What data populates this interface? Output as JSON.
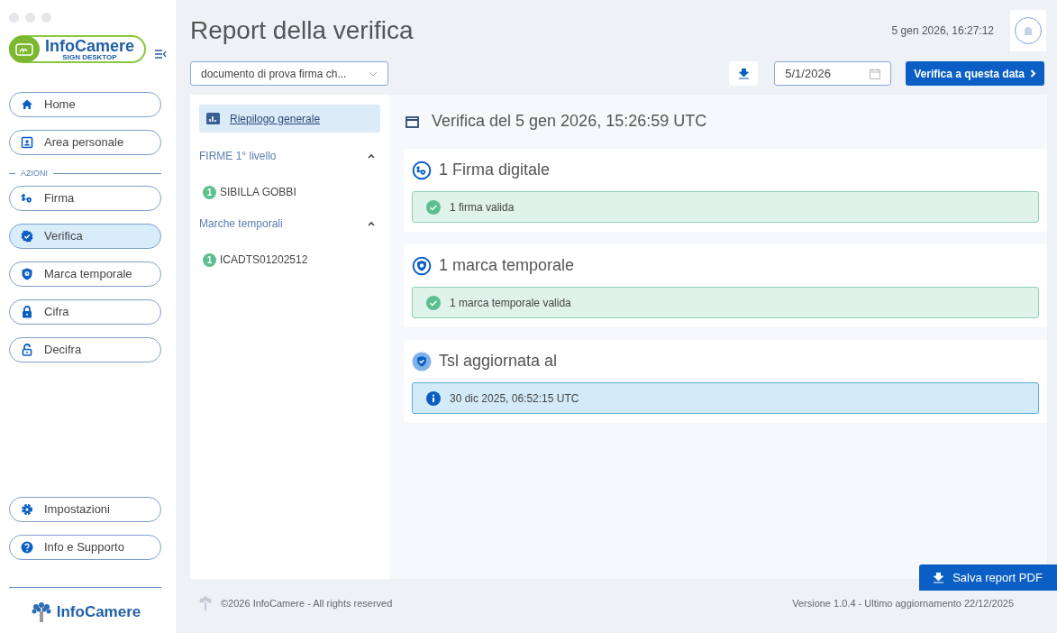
{
  "logo": {
    "title": "InfoCamere",
    "subtitle": "SIGN DESKTOP"
  },
  "nav_top": [
    {
      "label": "Home",
      "selected": false
    },
    {
      "label": "Area personale",
      "selected": false
    }
  ],
  "section_label": "AZIONI",
  "nav_actions": [
    {
      "label": "Firma",
      "selected": false
    },
    {
      "label": "Verifica",
      "selected": true
    },
    {
      "label": "Marca temporale",
      "selected": false
    },
    {
      "label": "Cifra",
      "selected": false
    },
    {
      "label": "Decifra",
      "selected": false
    }
  ],
  "nav_bottom": [
    {
      "label": "Impostazioni",
      "selected": false
    },
    {
      "label": "Info e Supporto",
      "selected": false
    }
  ],
  "brand_footer": "InfoCamere",
  "page_title": "Report della verifica",
  "datetime": "5 gen 2026, 16:27:12",
  "document_select": {
    "value": "documento di prova firma ch..."
  },
  "date_field": {
    "value": "5/1/2026"
  },
  "verify_button": "Verifica a questa data",
  "tree": {
    "summary": {
      "label": "Riepilogo generale",
      "selected": true
    },
    "groups": [
      {
        "label": "FIRME 1° livello",
        "expanded": true,
        "children": [
          {
            "count": "1",
            "label": "SIBILLA GOBBI"
          }
        ]
      },
      {
        "label": "Marche temporali",
        "expanded": true,
        "children": [
          {
            "count": "1",
            "label": "ICADTS01202512"
          }
        ]
      }
    ]
  },
  "verification_heading": "Verifica del 5 gen 2026, 15:26:59 UTC",
  "cards": [
    {
      "title": "1 Firma digitale",
      "status": {
        "kind": "success",
        "text": "1 firma valida"
      }
    },
    {
      "title": "1 marca temporale",
      "status": {
        "kind": "success",
        "text": "1 marca temporale valida"
      }
    },
    {
      "title": "Tsl aggiornata al",
      "status": {
        "kind": "info",
        "text": "30 dic 2025, 06:52:15 UTC"
      }
    }
  ],
  "save_button": "Salva report PDF",
  "footer": {
    "copyright": "©2026 InfoCamere - All rights reserved",
    "version": "Versione 1.0.4 - Ultimo aggiornamento 22/12/2025"
  }
}
